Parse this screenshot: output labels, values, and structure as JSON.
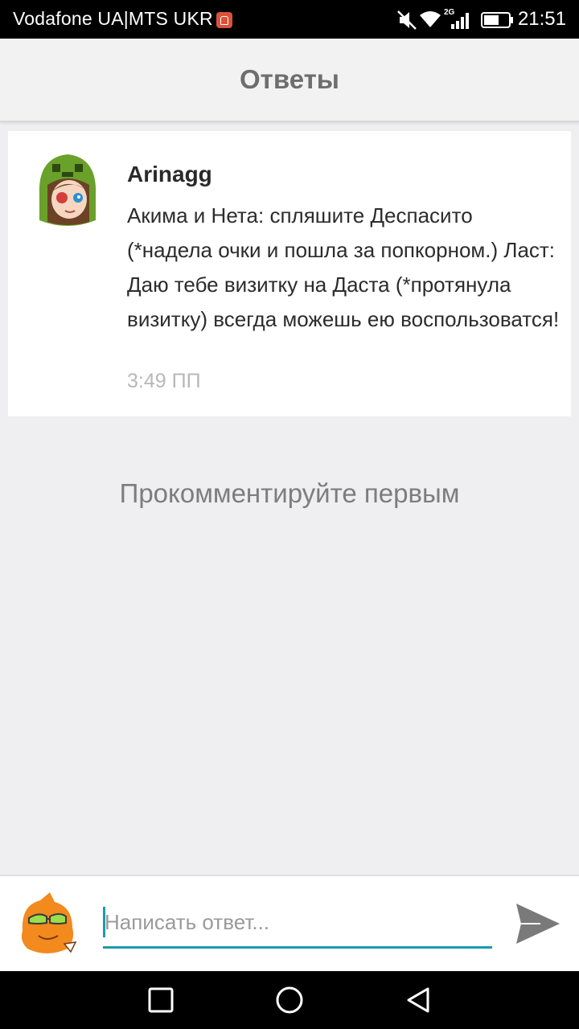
{
  "status_bar": {
    "carrier": "Vodafone UA|MTS UKR",
    "network": "2G",
    "time": "21:51",
    "icons": [
      "carrier-badge-icon",
      "mute-icon",
      "wifi-icon",
      "signal-icon",
      "battery-icon"
    ]
  },
  "header": {
    "title": "Ответы"
  },
  "comment": {
    "author": "Arinagg",
    "text": "Акима и Нета: спляшите Деспасито (*надела очки и пошла за попкорном.) Ласт: Даю тебе визитку на Даста (*протянула визитку) всегда можешь ею воспользоватся!",
    "time": "3:49 ПП"
  },
  "empty_hint": "Прокомментируйте первым",
  "reply": {
    "placeholder": "Написать ответ..."
  },
  "colors": {
    "accent": "#1a9bb0",
    "send": "#7a7a7a",
    "background": "#efeef0"
  },
  "nav_bar": {
    "icons": [
      "recents-square-icon",
      "home-circle-icon",
      "back-triangle-icon"
    ]
  }
}
